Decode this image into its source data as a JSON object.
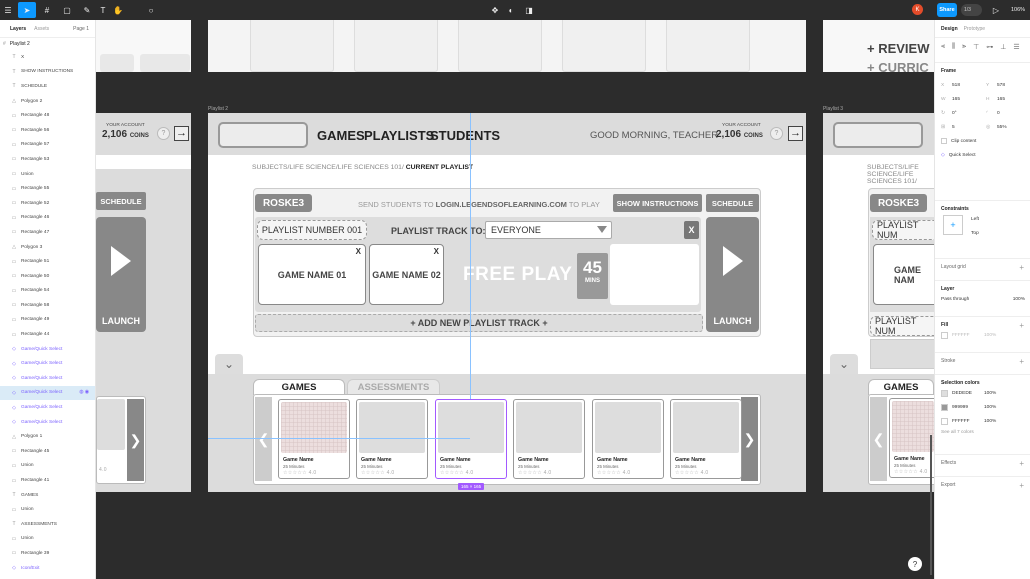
{
  "toolbar": {
    "share_label": "Share",
    "zoom": "106%",
    "user_initial": "K",
    "people_badge": "1/3"
  },
  "layers_panel": {
    "tabs": [
      "Layers",
      "Assets"
    ],
    "page": "Page 1",
    "root": "Playlist 2",
    "items": [
      {
        "label": "X",
        "icon": "T",
        "kind": "text"
      },
      {
        "label": "SHOW INSTRUCTIONS",
        "icon": "T",
        "kind": "text"
      },
      {
        "label": "SCHEDULE",
        "icon": "T",
        "kind": "text"
      },
      {
        "label": "Polygon 2",
        "icon": "△",
        "kind": "shape"
      },
      {
        "label": "Rectangle 48",
        "icon": "▭",
        "kind": "shape"
      },
      {
        "label": "Rectangle 56",
        "icon": "▭",
        "kind": "shape"
      },
      {
        "label": "Rectangle 57",
        "icon": "▭",
        "kind": "shape"
      },
      {
        "label": "Rectangle 53",
        "icon": "▭",
        "kind": "shape"
      },
      {
        "label": "Union",
        "icon": "▭",
        "kind": "shape"
      },
      {
        "label": "Rectangle 55",
        "icon": "▭",
        "kind": "shape"
      },
      {
        "label": "Rectangle 52",
        "icon": "▭",
        "kind": "shape"
      },
      {
        "label": "Rectangle 46",
        "icon": "▭",
        "kind": "shape"
      },
      {
        "label": "Rectangle 47",
        "icon": "▭",
        "kind": "shape"
      },
      {
        "label": "Polygon 3",
        "icon": "△",
        "kind": "shape"
      },
      {
        "label": "Rectangle 51",
        "icon": "▭",
        "kind": "shape"
      },
      {
        "label": "Rectangle 50",
        "icon": "▭",
        "kind": "shape"
      },
      {
        "label": "Rectangle 54",
        "icon": "▭",
        "kind": "shape"
      },
      {
        "label": "Rectangle 58",
        "icon": "▭",
        "kind": "shape"
      },
      {
        "label": "Rectangle 49",
        "icon": "▭",
        "kind": "shape"
      },
      {
        "label": "Rectangle 44",
        "icon": "▭",
        "kind": "shape"
      },
      {
        "label": "Game/Quick Select",
        "icon": "◇",
        "kind": "comp"
      },
      {
        "label": "Game/Quick Select",
        "icon": "◇",
        "kind": "comp"
      },
      {
        "label": "Game/Quick Select",
        "icon": "◇",
        "kind": "comp"
      },
      {
        "label": "Game/Quick Select",
        "icon": "◇",
        "kind": "comp-selected"
      },
      {
        "label": "Game/Quick Select",
        "icon": "◇",
        "kind": "comp"
      },
      {
        "label": "Game/Quick Select",
        "icon": "◇",
        "kind": "comp"
      },
      {
        "label": "Polygon 1",
        "icon": "△",
        "kind": "shape"
      },
      {
        "label": "Rectangle 45",
        "icon": "▭",
        "kind": "shape"
      },
      {
        "label": "Union",
        "icon": "▭",
        "kind": "shape"
      },
      {
        "label": "Rectangle 41",
        "icon": "▭",
        "kind": "shape"
      },
      {
        "label": "GAMES",
        "icon": "T",
        "kind": "text"
      },
      {
        "label": "Union",
        "icon": "▭",
        "kind": "shape"
      },
      {
        "label": "ASSESSMENTS",
        "icon": "T",
        "kind": "text"
      },
      {
        "label": "Union",
        "icon": "▭",
        "kind": "shape"
      },
      {
        "label": "Rectangle 39",
        "icon": "▭",
        "kind": "shape"
      },
      {
        "label": "Icon/Exit",
        "icon": "◇",
        "kind": "comp"
      }
    ]
  },
  "props_panel": {
    "tabs": [
      "Design",
      "Prototype"
    ],
    "frame_title": "Frame",
    "x": "518",
    "y": "578",
    "w": "165",
    "h": "165",
    "rotation": "0°",
    "radius": "0",
    "radius2": "5",
    "clip": "55%",
    "clip_content": "Clip content",
    "component": "Quick Select",
    "constraints_title": "Constraints",
    "constraint_h": "Left",
    "constraint_v": "Top",
    "layout_grid": "Layout grid",
    "layer_title": "Layer",
    "blend": "Pass through",
    "layer_opacity": "100%",
    "fill_title": "Fill",
    "fill_hex": "FFFFFF",
    "fill_opacity": "100%",
    "stroke_title": "Stroke",
    "selection_colors_title": "Selection colors",
    "selection_colors": [
      {
        "hex": "DEDEDE",
        "opacity": "100%",
        "color": "#DEDEDE"
      },
      {
        "hex": "999999",
        "opacity": "100%",
        "color": "#999999"
      },
      {
        "hex": "FFFFFF",
        "opacity": "100%",
        "color": "#FFFFFF"
      }
    ],
    "see_all": "See all 7 colors",
    "effects_title": "Effects",
    "export_title": "Export"
  },
  "canvas": {
    "frame_label_main": "Playlist 2",
    "frame_label_right": "Playlist 3",
    "right_review": [
      "+ REVIEW",
      "+ CURRIC"
    ],
    "header": {
      "nav": [
        "GAMES",
        "PLAYLISTS",
        "STUDENTS"
      ],
      "greeting": "GOOD MORNING, TEACHER",
      "account_label": "YOUR ACCOUNT",
      "coins_value": "2,106",
      "coins_unit": "COINS",
      "help": "?",
      "exit": "→"
    },
    "breadcrumb_path": "SUBJECTS/LIFE SCIENCE/LIFE SCIENCES 101/ ",
    "breadcrumb_current": "CURRENT PLAYLIST",
    "playlist": {
      "name": "ROSKE3",
      "send_prefix": "SEND STUDENTS TO ",
      "send_url": "LOGIN.LEGENDSOFLEARNING.COM",
      "send_suffix": " TO PLAY",
      "show_instructions": "SHOW INSTRUCTIONS",
      "schedule": "SCHEDULE",
      "track_number": "PLAYLIST NUMBER 001",
      "track_to_label": "PLAYLIST TRACK TO:",
      "track_to_value": "EVERYONE",
      "remove": "X",
      "games": [
        "GAME NAME 01",
        "GAME NAME 02"
      ],
      "free_play": "FREE PLAY",
      "minutes": "45",
      "minutes_unit": "MINS",
      "launch": "LAUNCH",
      "add_track": "+ ADD NEW PLAYLIST TRACK +"
    },
    "tabs": [
      "GAMES",
      "ASSESSMENTS"
    ],
    "tiles": [
      {
        "name": "Game Name",
        "minutes": "25 Minutes",
        "rating": "☆☆☆☆☆ 4.0"
      },
      {
        "name": "Game Name",
        "minutes": "25 Minutes",
        "rating": "☆☆☆☆☆ 4.0"
      },
      {
        "name": "Game Name",
        "minutes": "25 Minutes",
        "rating": "☆☆☆☆☆ 4.0"
      },
      {
        "name": "Game Name",
        "minutes": "25 Minutes",
        "rating": "☆☆☆☆☆ 4.0"
      },
      {
        "name": "Game Name",
        "minutes": "25 Minutes",
        "rating": "☆☆☆☆☆ 4.0"
      },
      {
        "name": "Game Name",
        "minutes": "25 Minutes",
        "rating": "☆☆☆☆☆ 4.0"
      }
    ],
    "size_badge": "165 × 165",
    "right_frame": {
      "playlist_name": "ROSKE3",
      "track_number": "PLAYLIST NUM",
      "track_number_2": "PLAYLIST NUM",
      "game": "GAME NAM",
      "tab": "GAMES",
      "tile_name": "Game Name",
      "tile_minutes": "25 Minutes",
      "tile_rating": "☆☆☆☆☆ 4.0"
    },
    "left_frame": {
      "schedule": "SCHEDULE",
      "launch": "LAUNCH",
      "tile_rating": "4.0"
    }
  },
  "colors": {
    "accent": "#0d99ff",
    "selection": "#a259ff",
    "component": "#7b61ff"
  }
}
